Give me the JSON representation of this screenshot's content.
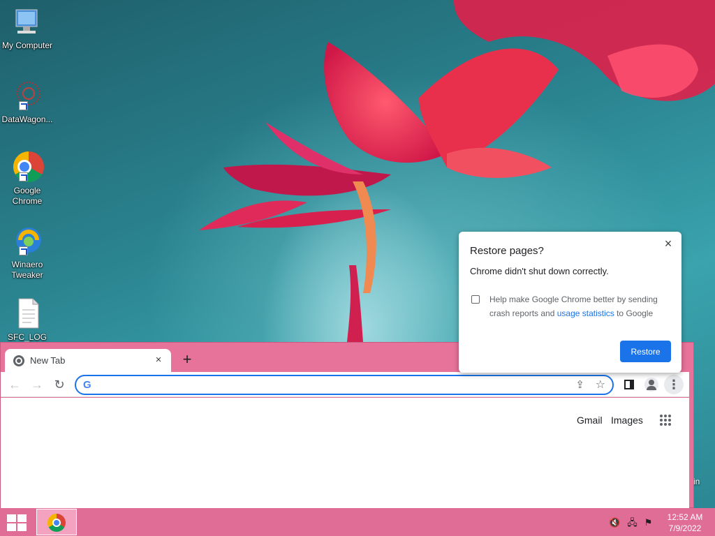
{
  "desktop": {
    "icons": [
      {
        "label": "My Computer",
        "icon": "computer-icon"
      },
      {
        "label": "DataWagon...",
        "icon": "datawagon-icon"
      },
      {
        "label": "Google Chrome",
        "icon": "chrome-icon"
      },
      {
        "label": "Winaero Tweaker",
        "icon": "winaero-icon"
      },
      {
        "label": "SFC_LOG",
        "icon": "document-icon"
      }
    ],
    "side_text": "in"
  },
  "chrome": {
    "tab": {
      "title": "New Tab",
      "close": "×"
    },
    "new_tab": "+",
    "toolbar": {
      "back": "←",
      "forward": "→",
      "reload": "↻",
      "omnibox_value": ""
    },
    "page": {
      "gmail": "Gmail",
      "images": "Images"
    }
  },
  "dialog": {
    "title": "Restore pages?",
    "message": "Chrome didn't shut down correctly.",
    "help_prefix": "Help make Google Chrome better by sending crash reports and ",
    "help_link": "usage statistics",
    "help_suffix": " to Google",
    "restore_label": "Restore",
    "close": "×"
  },
  "taskbar": {
    "time": "12:52 AM",
    "date": "7/9/2022"
  },
  "colors": {
    "accent": "#1a73e8",
    "frame": "#e8739a",
    "taskbar": "#e06d95"
  }
}
